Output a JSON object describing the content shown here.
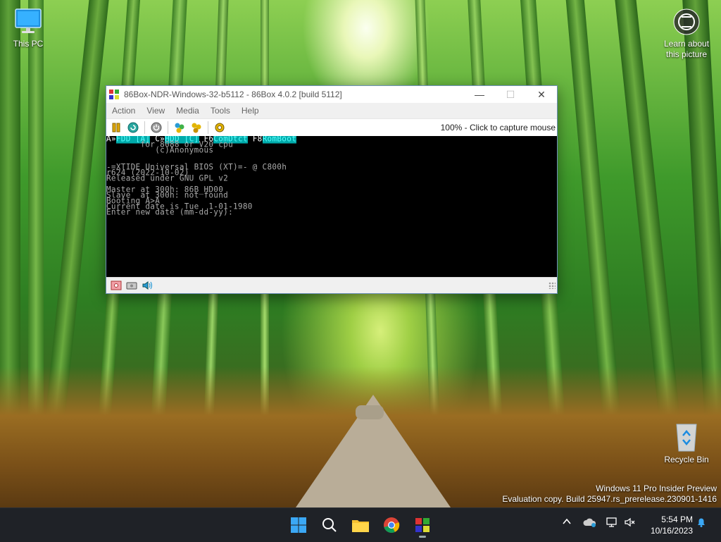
{
  "desktop": {
    "icons": [
      {
        "label": "This PC"
      },
      {
        "label": "Learn about this picture"
      },
      {
        "label": "Recycle Bin"
      }
    ],
    "watermark": {
      "line1": "Windows 11 Pro Insider Preview",
      "line2": "Evaluation copy. Build 25947.rs_prerelease.230901-1416"
    }
  },
  "window": {
    "title": "86Box-NDR-Windows-32-b5112 - 86Box 4.0.2 [build 5112]",
    "controls": {
      "minimize": "—",
      "maximize": "☐",
      "close": "✕"
    },
    "menu": [
      "Action",
      "View",
      "Media",
      "Tools",
      "Help"
    ],
    "toolbar": {
      "buttons": [
        "pause-icon",
        "reset-icon",
        "power-icon",
        "ctrl-alt-del-icon",
        "ctrl-alt-esc-icon",
        "settings-icon"
      ],
      "capture_text": "100% - Click to capture mouse"
    },
    "screen": {
      "line0": {
        "a": "A»",
        "b": "FDD [A]",
        "c": " C»",
        "d": "HDD [C]",
        "e": " F6",
        "f": "ComDtct",
        "g": " F8",
        "h": "RomBoot"
      },
      "lines": [
        "       for 8088 or V20 cpu",
        "          (c)Anonymous",
        "",
        "-=XTIDE Universal BIOS (XT)=- @ C800h",
        "r624 (2022-10-02)",
        "Released under GNU GPL v2",
        "",
        "Master at 300h: 86B_HD00",
        "Slave  at 300h: not found",
        "Booting A>A",
        "Current date is Tue  1-01-1980",
        "Enter new date (mm-dd-yy):"
      ]
    },
    "statusbar": [
      "floppy-drive-icon",
      "hard-disk-icon",
      "sound-icon"
    ]
  },
  "taskbar": {
    "apps": [
      "windows-start-icon",
      "search-icon",
      "file-explorer-icon",
      "chrome-icon",
      "86box-icon"
    ],
    "clock": {
      "time": "5:54 PM",
      "date": "10/16/2023"
    }
  }
}
